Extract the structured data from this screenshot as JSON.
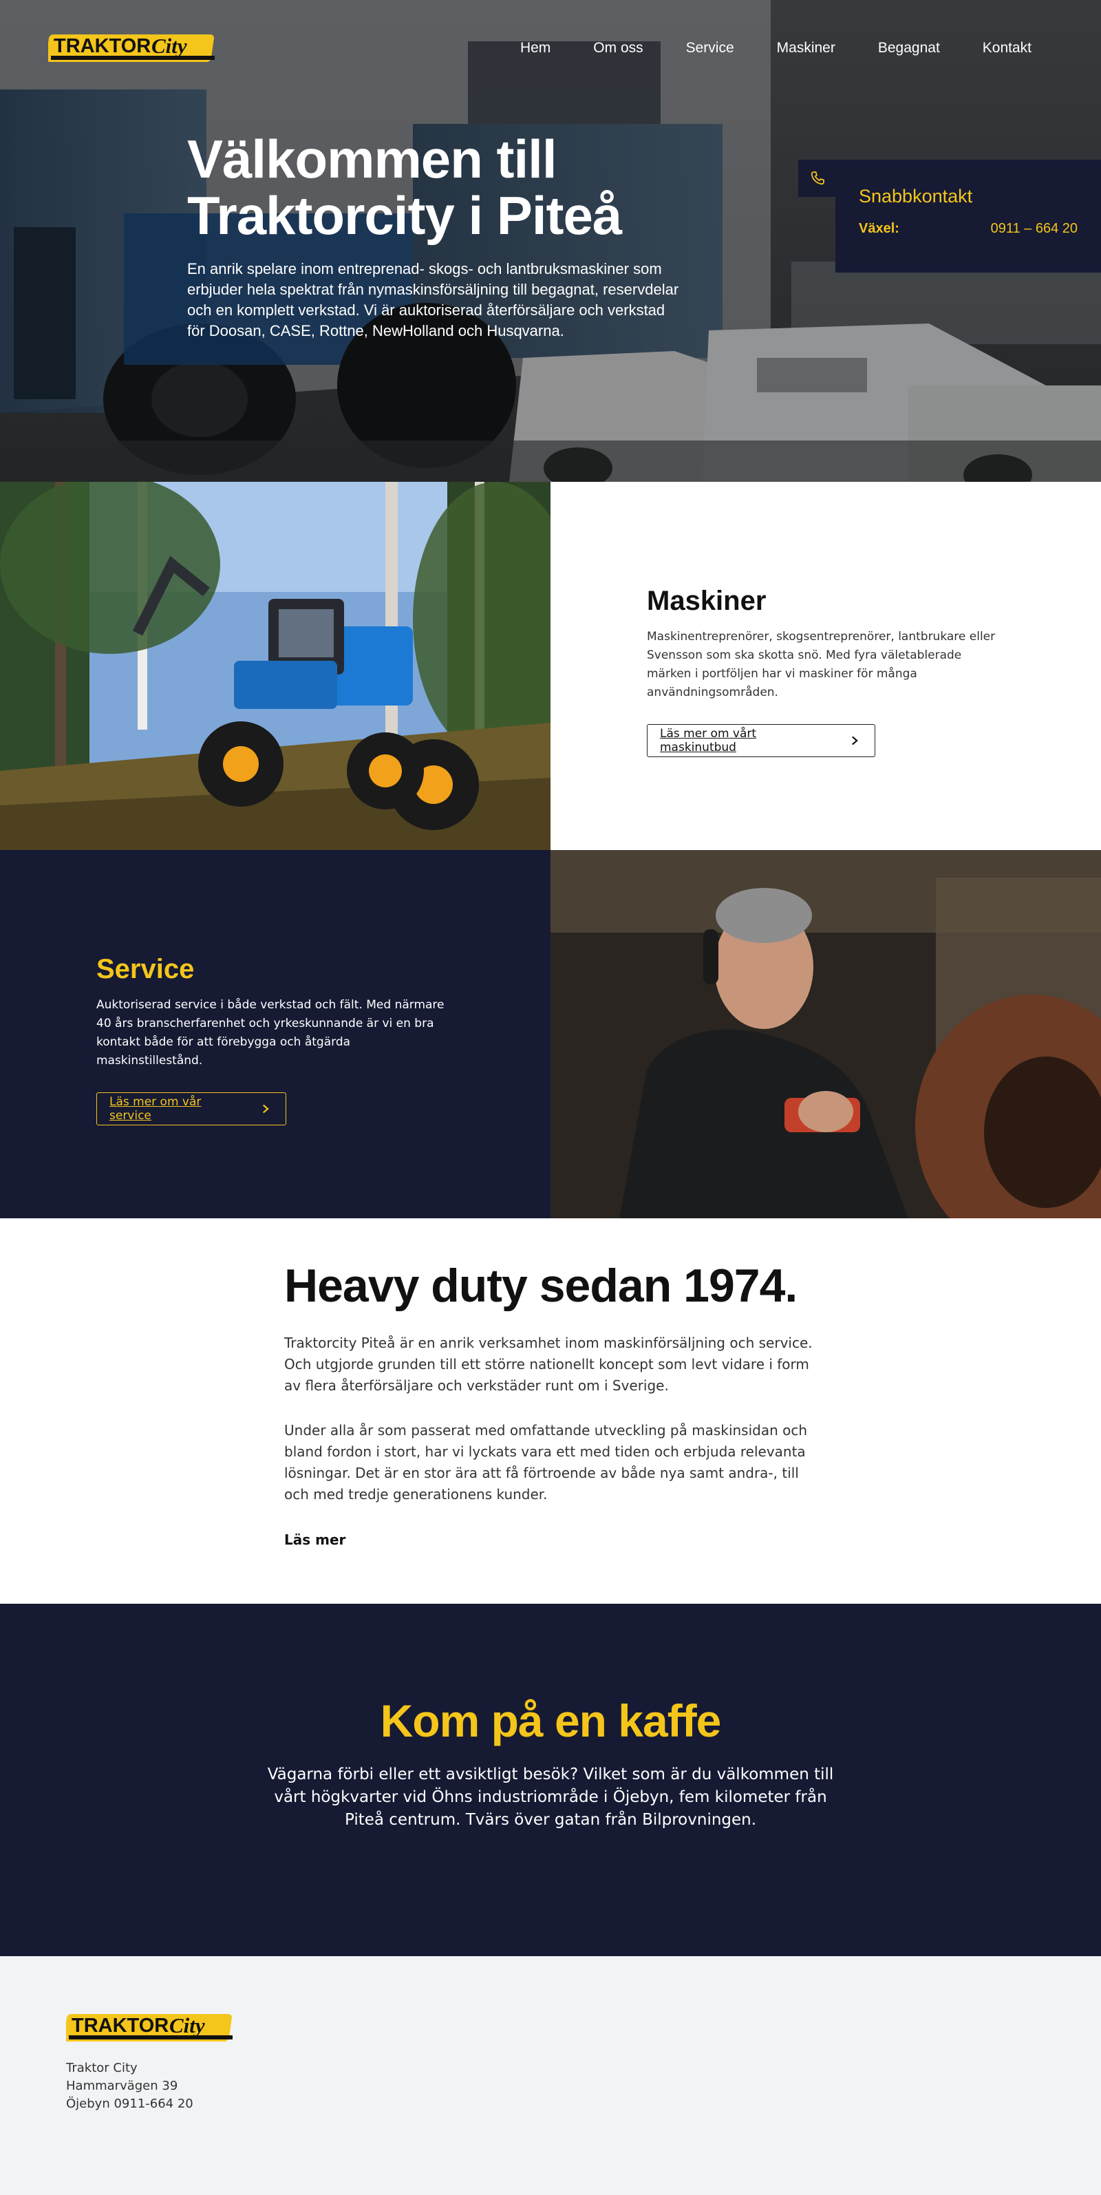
{
  "brand": {
    "logo_text_1": "TRAKTOR",
    "logo_text_2": "City"
  },
  "nav": {
    "items": [
      {
        "label": "Hem"
      },
      {
        "label": "Om oss"
      },
      {
        "label": "Service"
      },
      {
        "label": "Maskiner"
      },
      {
        "label": "Begagnat"
      },
      {
        "label": "Kontakt"
      }
    ]
  },
  "hero": {
    "title_line1": "Välkommen till",
    "title_line2": "Traktorcity i Piteå",
    "lead": "En anrik spelare inom entreprenad- skogs- och lantbruksmaskiner som erbjuder hela spektrat från nymaskinsförsäljning till begagnat, reservdelar och en komplett verkstad. Vi är auktoriserad återförsäljare och verkstad för Doosan, CASE, Rottne, NewHolland och Husqvarna."
  },
  "quick_contact": {
    "icon": "phone-icon",
    "title": "Snabbkontakt",
    "label": "Växel:",
    "value": "0911 – 664 20"
  },
  "maskiner": {
    "image": "forestry-machine-image",
    "title": "Maskiner",
    "text": "Maskinentreprenörer, skogsentreprenörer, lantbrukare eller Svensson som ska skotta snö. Med fyra väletablerade märken i portföljen har vi maskiner för många användningsområden.",
    "button": "Läs mer om vårt maskinutbud"
  },
  "service": {
    "image": "mechanic-image",
    "title": "Service",
    "text": "Auktoriserad service i både verkstad och fält. Med närmare 40 års branscherfarenhet och yrkeskunnande är vi en bra kontakt både för att förebygga och åtgärda maskinstillestånd.",
    "button": "Läs mer om vår service"
  },
  "story": {
    "title": "Heavy duty sedan 1974.",
    "p1": "Traktorcity Piteå är en anrik verksamhet inom maskinförsäljning och service. Och utgjorde grunden till ett större nationellt koncept som levt vidare i form av flera återförsäljare och verkstäder runt om i Sverige.",
    "p2": "Under alla år som passerat med omfattande utveckling på maskinsidan och bland fordon i stort, har vi lyckats vara ett med tiden och erbjuda relevanta lösningar. Det är en stor ära att få förtroende av både nya samt andra-, till och med tredje generationens kunder.",
    "link": "Läs mer"
  },
  "coffee": {
    "title": "Kom på en kaffe",
    "text": "Vägarna förbi eller ett avsiktligt besök? Vilket som är du välkommen till vårt högkvarter vid Öhns industriområde i Öjebyn, fem kilometer från Piteå centrum. Tvärs över gatan från Bilprovningen."
  },
  "footer": {
    "line1": "Traktor City",
    "line2": "Hammarvägen 39",
    "line3": "Öjebyn 0911-664 20"
  },
  "colors": {
    "navy": "#161a33",
    "yellow": "#f4c51b",
    "light_gray": "#f2f3f5"
  }
}
